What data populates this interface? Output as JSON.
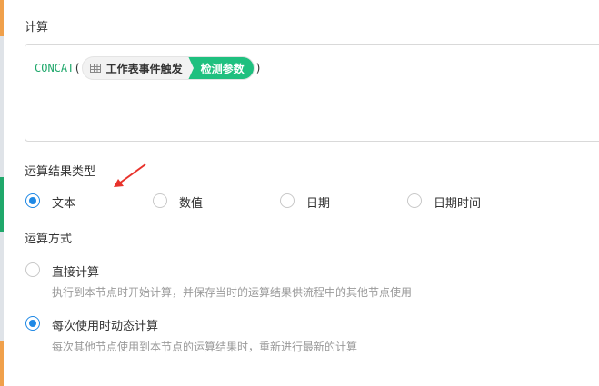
{
  "calculation": {
    "title": "计算",
    "formula": {
      "function_name": "CONCAT",
      "open_paren": "(",
      "close_paren": ")",
      "param_node_icon": "table-grid-icon",
      "param_node": "工作表事件触发",
      "param_field": "检测参数",
      "accent_color": "#1fc07f"
    }
  },
  "result_type": {
    "title": "运算结果类型",
    "options": [
      {
        "label": "文本",
        "checked": true
      },
      {
        "label": "数值",
        "checked": false
      },
      {
        "label": "日期",
        "checked": false
      },
      {
        "label": "日期时间",
        "checked": false
      }
    ]
  },
  "calc_mode": {
    "title": "运算方式",
    "options": [
      {
        "label": "直接计算",
        "description": "执行到本节点时开始计算，并保存当时的运算结果供流程中的其他节点使用",
        "checked": false
      },
      {
        "label": "每次使用时动态计算",
        "description": "每次其他节点使用到本节点的运算结果时，重新进行最新的计算",
        "checked": true
      }
    ]
  },
  "annotation": {
    "icon": "red-arrow-icon",
    "color": "#e8322b"
  },
  "colors": {
    "radio_checked": "#1e88e5"
  }
}
